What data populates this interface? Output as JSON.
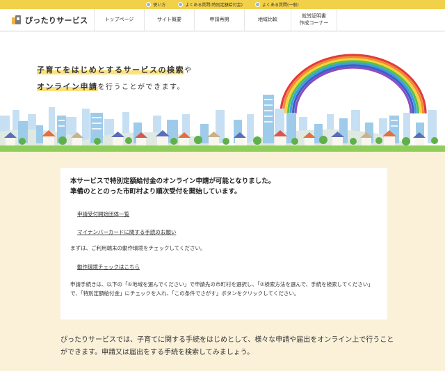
{
  "util_links": [
    "使い方",
    "よくある質問(特別定額給付金)",
    "よくある質問(一般)"
  ],
  "logo_text": "ぴったりサービス",
  "nav": [
    {
      "label": "トップページ"
    },
    {
      "label": "サイト概要"
    },
    {
      "label": "申請再開"
    },
    {
      "label": "地域比較"
    },
    {
      "label": "就労証明書\n作成コーナー"
    }
  ],
  "hero": {
    "line1_highlight": "子育てをはじめとするサービスの検索",
    "line1_rest": "や",
    "line2_highlight": "オンライン申請",
    "line2_rest": "を行うことができます。"
  },
  "notice": {
    "heading_line1": "本サービスで特別定額給付金のオンライン申請が可能となりました。",
    "heading_line2": "準備のととのった市町村より順次受付を開始しています。",
    "link1": "申請受付開始団体一覧",
    "link2": "マイナンバーカードに関する手続のお願い",
    "check_text": "まずは、ご利用端末の動作環境をチェックしてください。",
    "link3": "動作環境チェックはこちら",
    "procedure_text": "申請手続きは、以下の「①地域を選んでください」で申請先の市町村を選択し、「②検索方法を選んで、手続を検索してください」で、「特別定額給付金」にチェックを入れ、「この条件でさがす」ボタンをクリックしてください。"
  },
  "bottom_text": "ぴったりサービスでは、子育てに関する手続をはじめとして、様々な申請や届出をオンライン上で行うことができます。申請又は届出をする手続を検索してみましょう。",
  "colors": {
    "accent_yellow": "#f2d14a",
    "background": "#fbf1d9",
    "highlight": "#fbe27a"
  }
}
